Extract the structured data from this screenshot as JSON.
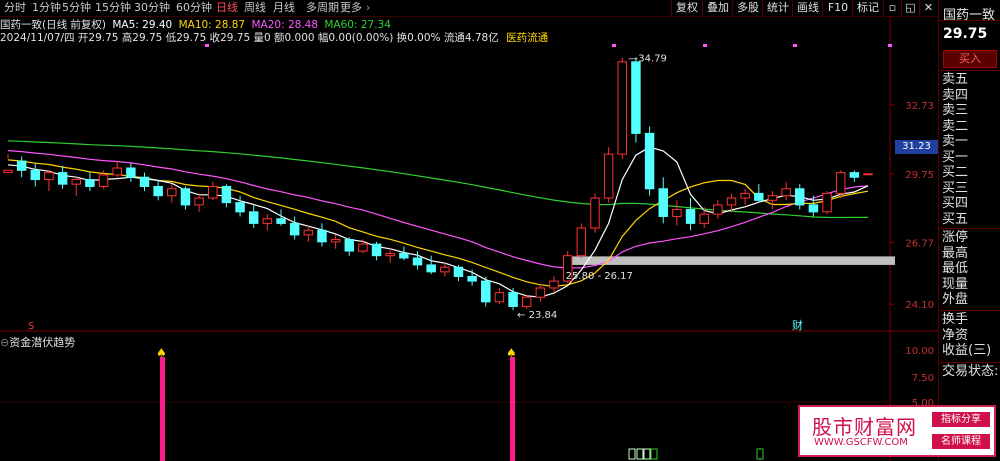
{
  "toolbar": {
    "periods": [
      "分时",
      "1分钟",
      "5分钟",
      "15分钟",
      "30分钟",
      "60分钟",
      "日线",
      "周线",
      "月线",
      "多周期",
      "更多"
    ],
    "active_period": "日线",
    "buttons": [
      "复权",
      "叠加",
      "多股",
      "统计",
      "画线",
      "F10",
      "标记"
    ],
    "more_caret": "›"
  },
  "info": {
    "stock_name": "国药一致(日线 前复权)",
    "ma5": "MA5: 29.40",
    "ma10": "MA10: 28.87",
    "ma20": "MA20: 28.48",
    "ma60": "MA60: 27.34",
    "bar_info": "2024/11/07/四 开29.75 高29.75 低29.75 收29.75 量0 额0.000 幅0.00(0.00%) 换0.00% 流通4.78亿",
    "sector": "医药流通"
  },
  "axis": {
    "price_ticks": [
      "32.73",
      "29.75",
      "26.77",
      "24.10"
    ],
    "current_price_tag": "31.23",
    "indicator_ticks": [
      "10.00",
      "7.50",
      "5.00"
    ]
  },
  "annotations": {
    "high": "34.79",
    "low": "23.84",
    "range_band": "25.80 - 26.17",
    "s_marker": "S",
    "cai_marker": "财"
  },
  "indicator": {
    "name": "资金潜伏趋势"
  },
  "right_panel": {
    "stock_title": "国药一致",
    "price": "29.75",
    "buy_button": "买入",
    "order_book": [
      "卖五",
      "卖四",
      "卖三",
      "卖二",
      "卖一",
      "买一",
      "买二",
      "买三",
      "买四",
      "买五"
    ],
    "stats": [
      "涨停",
      "最高",
      "最低",
      "现量",
      "外盘",
      "换手",
      "净资",
      "收益(三)",
      "交易状态:"
    ]
  },
  "watermark": {
    "logo": "股市财富网",
    "url": "WWW.GSCFW.COM",
    "tag1": "指标分享",
    "tag2": "名师课程"
  },
  "colors": {
    "up": "#ff3030",
    "down": "#54ffff",
    "ma5": "#ffffff",
    "ma10": "#ffd700",
    "ma20": "#ff55ff",
    "ma60": "#30d030",
    "signal": "#ff1a8c"
  },
  "chart_data": {
    "type": "candlestick",
    "y_range": [
      23.5,
      35.2
    ],
    "candles": [
      [
        29.8,
        30.6,
        30.4,
        29.9
      ],
      [
        30.3,
        30.5,
        29.6,
        29.9
      ],
      [
        29.9,
        30.2,
        29.2,
        29.5
      ],
      [
        29.5,
        29.9,
        29.0,
        29.8
      ],
      [
        29.8,
        30.1,
        29.1,
        29.3
      ],
      [
        29.3,
        29.6,
        28.8,
        29.5
      ],
      [
        29.5,
        29.8,
        29.0,
        29.2
      ],
      [
        29.2,
        29.9,
        29.1,
        29.7
      ],
      [
        29.7,
        30.3,
        29.6,
        30.0
      ],
      [
        30.0,
        30.2,
        29.4,
        29.6
      ],
      [
        29.6,
        29.8,
        29.0,
        29.2
      ],
      [
        29.2,
        29.5,
        28.6,
        28.8
      ],
      [
        28.8,
        29.3,
        28.5,
        29.1
      ],
      [
        29.1,
        29.2,
        28.2,
        28.4
      ],
      [
        28.4,
        28.9,
        28.1,
        28.7
      ],
      [
        28.7,
        29.4,
        28.6,
        29.2
      ],
      [
        29.2,
        29.3,
        28.3,
        28.5
      ],
      [
        28.5,
        28.8,
        27.9,
        28.1
      ],
      [
        28.1,
        28.4,
        27.4,
        27.6
      ],
      [
        27.6,
        28.0,
        27.3,
        27.8
      ],
      [
        27.8,
        28.2,
        27.5,
        27.6
      ],
      [
        27.6,
        27.9,
        26.9,
        27.1
      ],
      [
        27.1,
        27.5,
        26.8,
        27.3
      ],
      [
        27.3,
        27.6,
        26.6,
        26.8
      ],
      [
        26.8,
        27.1,
        26.5,
        26.9
      ],
      [
        26.9,
        27.0,
        26.2,
        26.4
      ],
      [
        26.4,
        26.9,
        26.3,
        26.7
      ],
      [
        26.7,
        26.8,
        26.0,
        26.2
      ],
      [
        26.2,
        26.5,
        25.9,
        26.3
      ],
      [
        26.3,
        26.6,
        26.0,
        26.1
      ],
      [
        26.1,
        26.4,
        25.6,
        25.8
      ],
      [
        25.8,
        26.2,
        25.4,
        25.5
      ],
      [
        25.5,
        25.9,
        25.3,
        25.7
      ],
      [
        25.7,
        25.8,
        25.1,
        25.3
      ],
      [
        25.3,
        25.6,
        24.9,
        25.1
      ],
      [
        25.1,
        25.3,
        24.0,
        24.2
      ],
      [
        24.2,
        24.8,
        24.1,
        24.6
      ],
      [
        24.6,
        24.8,
        23.84,
        24.0
      ],
      [
        24.0,
        24.5,
        23.9,
        24.4
      ],
      [
        24.4,
        25.0,
        24.2,
        24.8
      ],
      [
        24.8,
        25.3,
        24.6,
        25.1
      ],
      [
        25.1,
        26.4,
        25.0,
        26.2
      ],
      [
        26.2,
        27.6,
        26.1,
        27.4
      ],
      [
        27.4,
        28.9,
        27.2,
        28.7
      ],
      [
        28.7,
        30.9,
        28.5,
        30.6
      ],
      [
        30.6,
        34.79,
        30.4,
        34.6
      ],
      [
        34.6,
        34.8,
        31.1,
        31.5
      ],
      [
        31.5,
        31.8,
        28.8,
        29.1
      ],
      [
        29.1,
        29.6,
        27.6,
        27.9
      ],
      [
        27.9,
        28.6,
        27.5,
        28.2
      ],
      [
        28.2,
        28.7,
        27.3,
        27.6
      ],
      [
        27.6,
        28.3,
        27.4,
        28.0
      ],
      [
        28.0,
        28.6,
        27.8,
        28.4
      ],
      [
        28.4,
        28.9,
        28.1,
        28.7
      ],
      [
        28.7,
        29.1,
        28.4,
        28.9
      ],
      [
        28.9,
        29.3,
        28.5,
        28.6
      ],
      [
        28.6,
        29.0,
        28.2,
        28.8
      ],
      [
        28.8,
        29.4,
        28.6,
        29.1
      ],
      [
        29.1,
        29.3,
        28.2,
        28.4
      ],
      [
        28.4,
        28.8,
        27.9,
        28.1
      ],
      [
        28.1,
        29.0,
        28.0,
        28.9
      ],
      [
        28.9,
        29.9,
        28.7,
        29.8
      ],
      [
        29.8,
        29.9,
        29.4,
        29.6
      ],
      [
        29.75,
        29.75,
        29.75,
        29.75
      ]
    ],
    "signal_bars": [
      10,
      47
    ]
  }
}
